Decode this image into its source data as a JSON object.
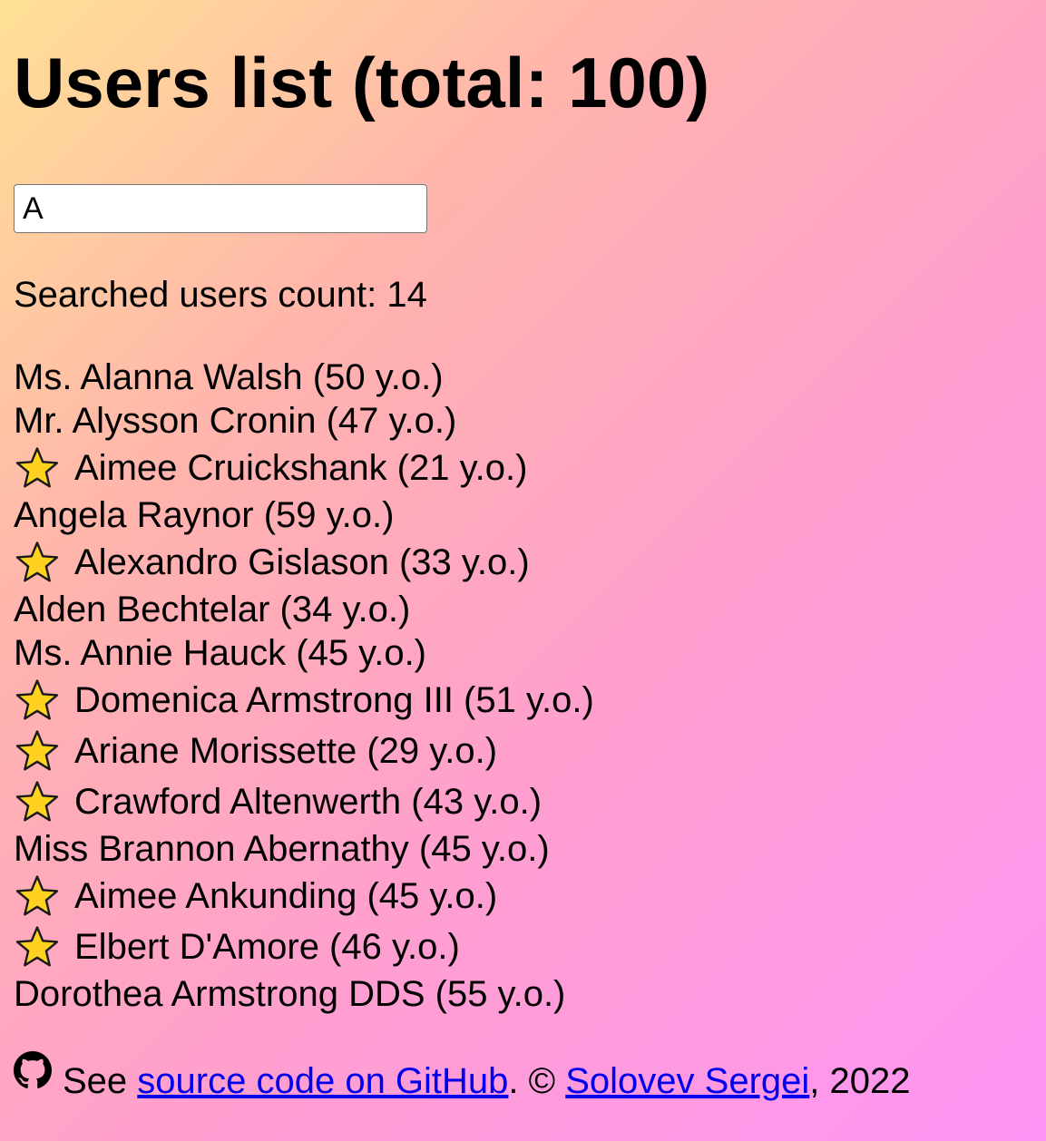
{
  "title": "Users list (total: 100)",
  "search": {
    "value": "A",
    "placeholder": ""
  },
  "count_label": "Searched users count: 14",
  "users": [
    {
      "text": "Ms. Alanna Walsh (50 y.o.)",
      "starred": false
    },
    {
      "text": "Mr. Alysson Cronin (47 y.o.)",
      "starred": false
    },
    {
      "text": "Aimee Cruickshank (21 y.o.)",
      "starred": true
    },
    {
      "text": "Angela Raynor (59 y.o.)",
      "starred": false
    },
    {
      "text": "Alexandro Gislason (33 y.o.)",
      "starred": true
    },
    {
      "text": "Alden Bechtelar (34 y.o.)",
      "starred": false
    },
    {
      "text": "Ms. Annie Hauck (45 y.o.)",
      "starred": false
    },
    {
      "text": "Domenica Armstrong III (51 y.o.)",
      "starred": true
    },
    {
      "text": "Ariane Morissette (29 y.o.)",
      "starred": true
    },
    {
      "text": "Crawford Altenwerth (43 y.o.)",
      "starred": true
    },
    {
      "text": "Miss Brannon Abernathy (45 y.o.)",
      "starred": false
    },
    {
      "text": "Aimee Ankunding (45 y.o.)",
      "starred": true
    },
    {
      "text": "Elbert D'Amore (46 y.o.)",
      "starred": true
    },
    {
      "text": "Dorothea Armstrong DDS (55 y.o.)",
      "starred": false
    }
  ],
  "footer": {
    "see": "See ",
    "source_link": "source code on GitHub",
    "copyright": ". © ",
    "author_link": "Solovev Sergei",
    "year": ", 2022"
  },
  "icons": {
    "star": "star-icon",
    "github": "github-icon"
  },
  "colors": {
    "link": "#0000ee",
    "star_fill": "#ffd21f",
    "gradient_start": "#ffe095",
    "gradient_end": "#fd95f5"
  }
}
